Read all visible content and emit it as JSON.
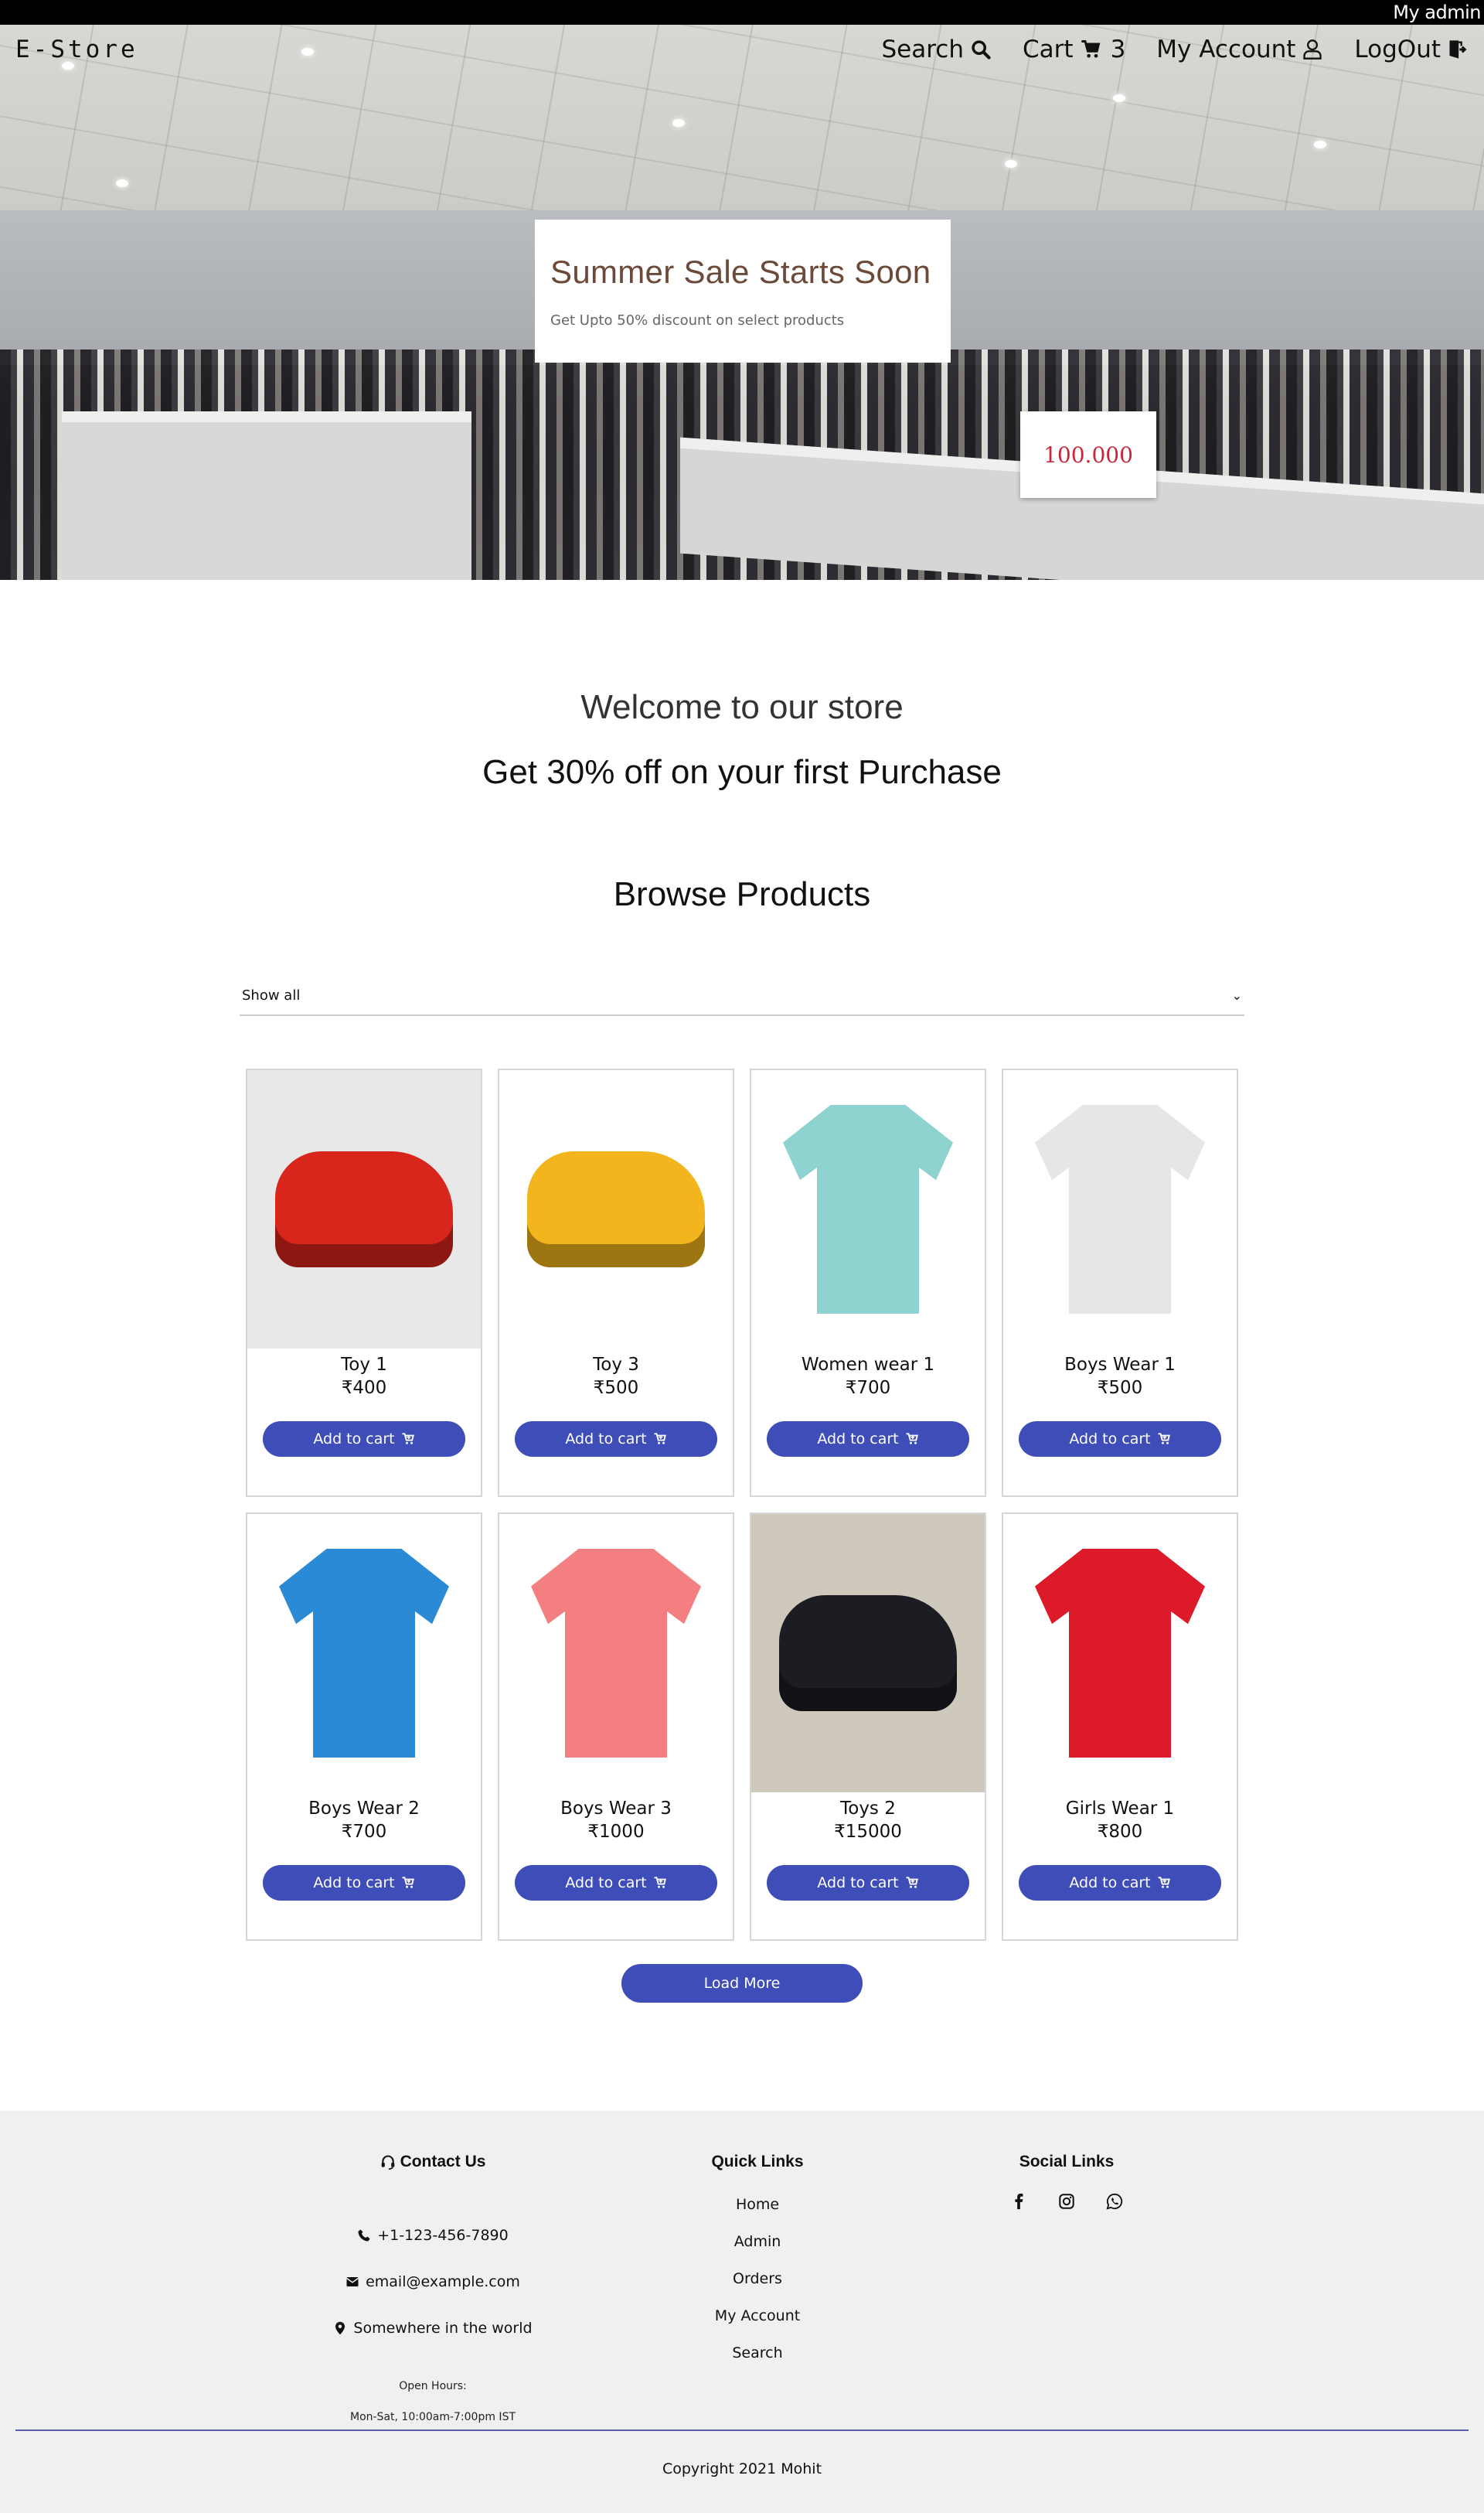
{
  "admin_bar": {
    "label": "My admin"
  },
  "header": {
    "brand": "E-Store",
    "nav": [
      {
        "label": "Search",
        "icon": "search-icon"
      },
      {
        "label": "Cart",
        "icon": "cart-icon",
        "count": "3"
      },
      {
        "label": "My Account",
        "icon": "user-icon"
      },
      {
        "label": "LogOut",
        "icon": "logout-icon"
      }
    ]
  },
  "hero": {
    "title": "Summer Sale Starts Soon",
    "subtitle": "Get Upto 50% discount on select products",
    "price_tag": "100.000"
  },
  "welcome": {
    "title": "Welcome to our store",
    "offer": "Get 30% off on your first Purchase"
  },
  "browse": {
    "title": "Browse Products",
    "filter_selected": "Show all"
  },
  "products": [
    {
      "name": "Toy 1",
      "price": "₹400",
      "button": "Add to cart",
      "image": "red-race-car-toy",
      "colors": [
        "#e8e8e8",
        "#d9261c"
      ]
    },
    {
      "name": "Toy 3",
      "price": "₹500",
      "button": "Add to cart",
      "image": "yellow-construction-vehicles-set",
      "colors": [
        "#ffffff",
        "#f2b51d"
      ]
    },
    {
      "name": "Women wear 1",
      "price": "₹700",
      "button": "Add to cart",
      "image": "teal-striped-kurta",
      "colors": [
        "#ffffff",
        "#8fd3d1"
      ]
    },
    {
      "name": "Boys Wear 1",
      "price": "₹500",
      "button": "Add to cart",
      "image": "grey-spiderman-tshirt",
      "colors": [
        "#ffffff",
        "#e6e6e8"
      ]
    },
    {
      "name": "Boys Wear 2",
      "price": "₹700",
      "button": "Add to cart",
      "image": "blue-keep-on-rollin-tshirt",
      "colors": [
        "#ffffff",
        "#2a8ad6"
      ]
    },
    {
      "name": "Boys Wear 3",
      "price": "₹1000",
      "button": "Add to cart",
      "image": "pink-lightning-tshirt",
      "colors": [
        "#ffffff",
        "#f47f80"
      ]
    },
    {
      "name": "Toys 2",
      "price": "₹15000",
      "button": "Add to cart",
      "image": "blue-ride-on-jeep",
      "colors": [
        "#cfc8bd",
        "#1c1d22"
      ]
    },
    {
      "name": "Girls Wear 1",
      "price": "₹800",
      "button": "Add to cart",
      "image": "red-daddys-little-cutie-tshirt",
      "colors": [
        "#ffffff",
        "#dd1a2a"
      ]
    }
  ],
  "load_more": "Load More",
  "footer": {
    "contact": {
      "title": "Contact Us",
      "phone": "+1-123-456-7890",
      "email": "email@example.com",
      "address": "Somewhere in the world",
      "hours_label": "Open Hours:",
      "hours": "Mon-Sat, 10:00am-7:00pm IST"
    },
    "quick_links": {
      "title": "Quick Links",
      "items": [
        "Home",
        "Admin",
        "Orders",
        "My Account",
        "Search"
      ]
    },
    "social": {
      "title": "Social Links",
      "icons": [
        "facebook-icon",
        "instagram-icon",
        "whatsapp-icon"
      ]
    },
    "copyright": "Copyright 2021 Mohit"
  },
  "colors": {
    "accent": "#3f4db8",
    "promo_title": "#6b4a3a",
    "footer_bg": "#f0f0f0",
    "divider": "#5c5ca8"
  }
}
